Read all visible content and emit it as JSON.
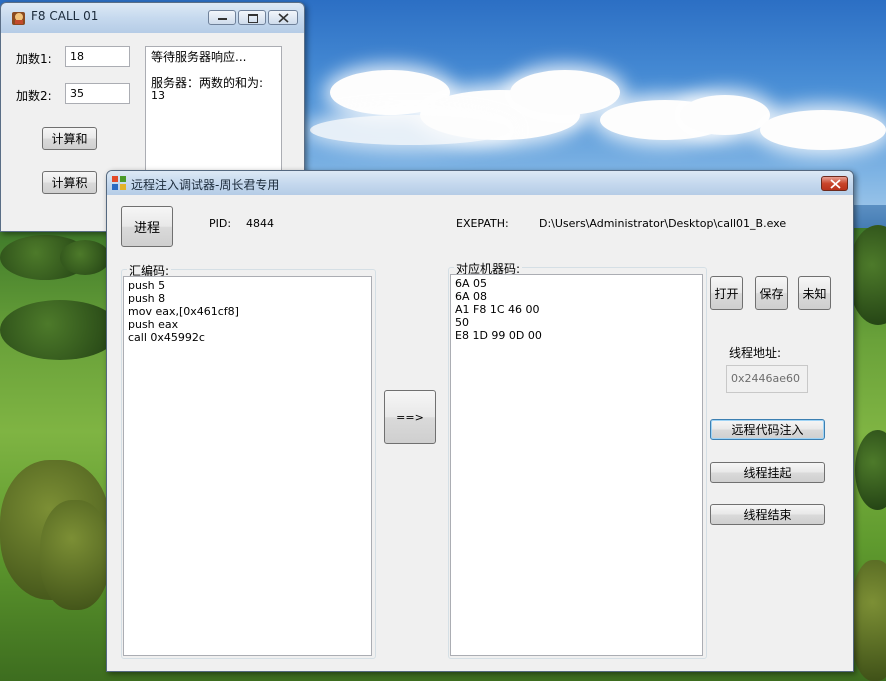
{
  "desktop": {
    "wallpaper": "landscape"
  },
  "calc_window": {
    "title": "F8 CALL 01",
    "addend1_label": "加数1:",
    "addend1_value": "18",
    "addend2_label": "加数2:",
    "addend2_value": "35",
    "sum_button": "计算和",
    "product_button": "计算积",
    "status_line1": "等待服务器响应...",
    "status_line2": "服务器：两数的和为:",
    "status_line3": "13",
    "icon": "app-icon"
  },
  "injector_window": {
    "title": "远程注入调试器-周长君专用",
    "process_button": "进程",
    "pid_label": "PID:",
    "pid_value": "4844",
    "exepath_label": "EXEPATH:",
    "exepath_value": "D:\\Users\\Administrator\\Desktop\\call01_B.exe",
    "asm_group_title": "汇编码:",
    "asm_lines": [
      "push 5",
      "push 8",
      "mov eax,[0x461cf8]",
      "push eax",
      "call 0x45992c"
    ],
    "convert_button": "==>",
    "machine_group_title": "对应机器码:",
    "machine_lines": [
      "6A 05",
      "6A 08",
      "A1 F8 1C 46 00",
      "50",
      "E8 1D 99 0D 00"
    ],
    "open_button": "打开",
    "save_button": "保存",
    "unknown_button": "未知",
    "thread_address_label": "线程地址:",
    "thread_address_value": "0x2446ae60",
    "inject_button": "远程代码注入",
    "suspend_button": "线程挂起",
    "terminate_button": "线程结束",
    "icon": "app-icon"
  }
}
